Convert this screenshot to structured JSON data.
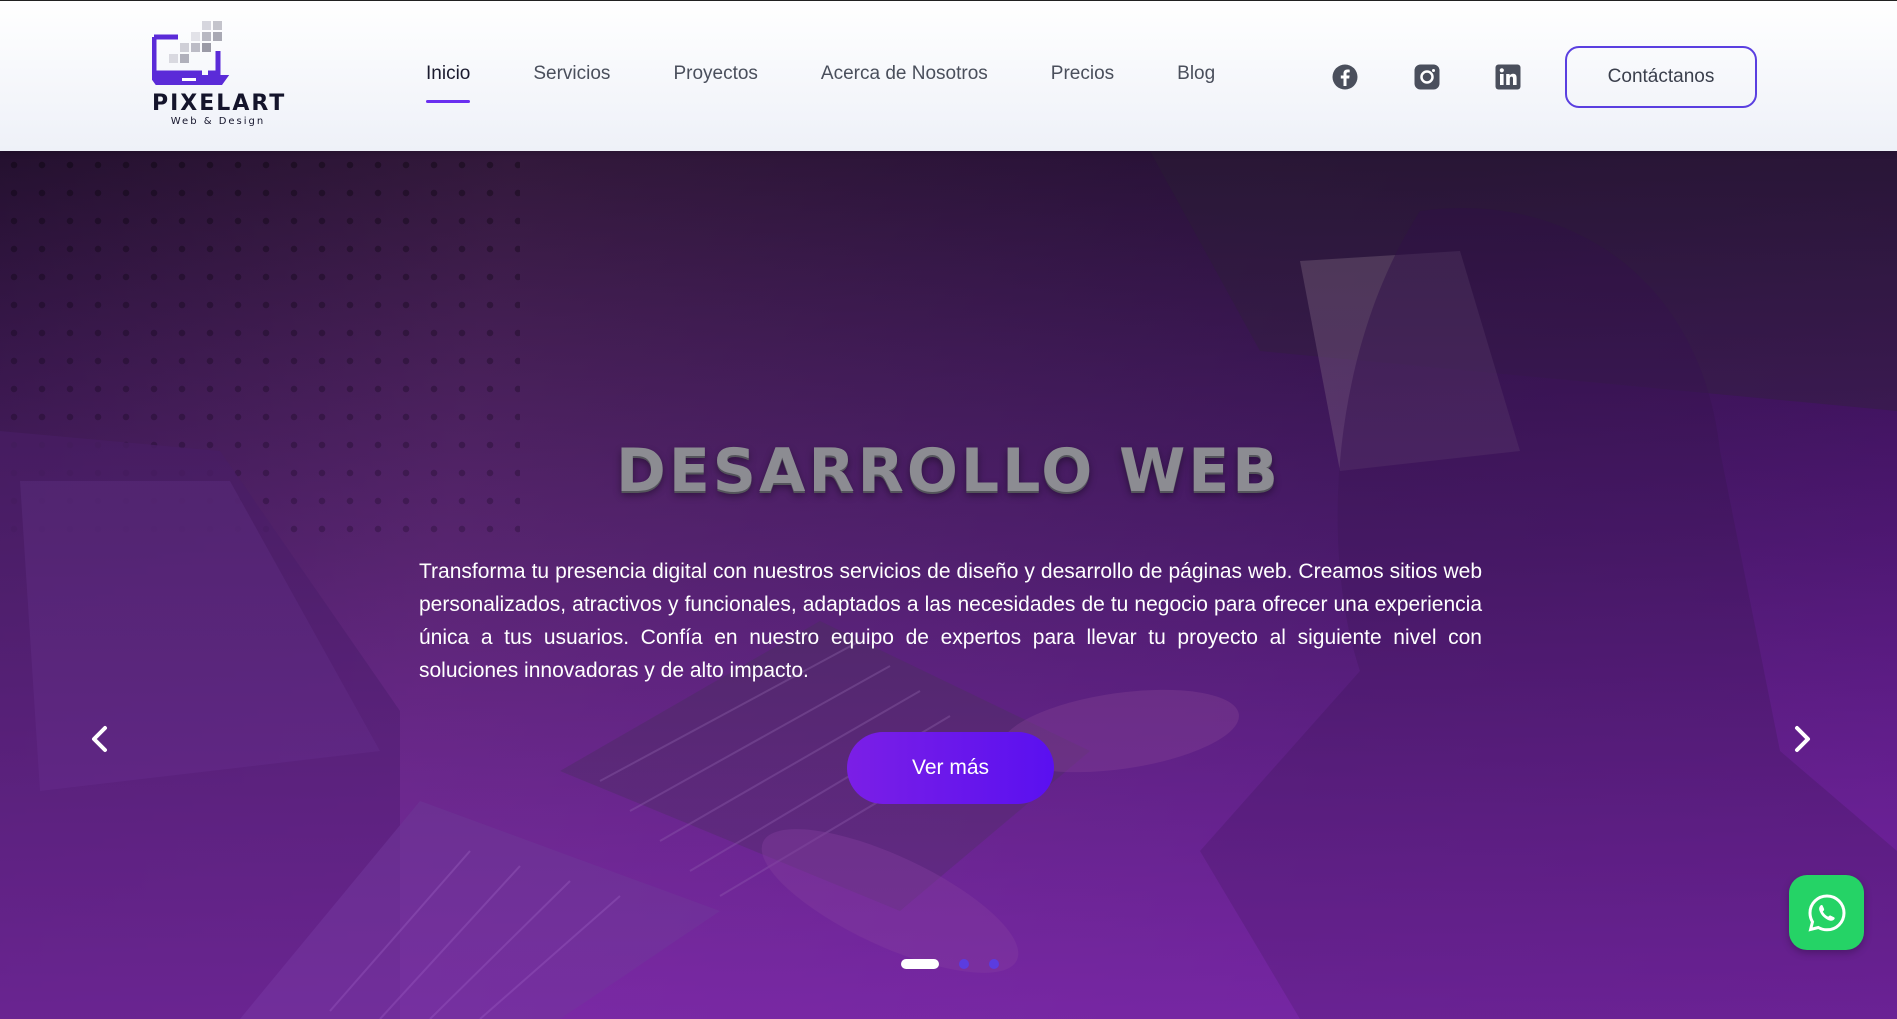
{
  "brand": {
    "name": "PIXELART",
    "tagline": "Web & Design",
    "accent_color": "#6a2ff0",
    "text_color": "#14142b"
  },
  "nav": {
    "items": [
      {
        "label": "Inicio",
        "active": true
      },
      {
        "label": "Servicios",
        "active": false
      },
      {
        "label": "Proyectos",
        "active": false
      },
      {
        "label": "Acerca de Nosotros",
        "active": false
      },
      {
        "label": "Precios",
        "active": false
      },
      {
        "label": "Blog",
        "active": false
      }
    ]
  },
  "social": {
    "icons": [
      "facebook-icon",
      "instagram-icon",
      "linkedin-icon"
    ]
  },
  "header": {
    "contact_label": "Contáctanos"
  },
  "hero": {
    "title": "DESARROLLO WEB",
    "description": "Transforma tu presencia digital con nuestros servicios de diseño y desarrollo de páginas web. Creamos sitios web personalizados, atractivos y funcionales, adaptados a las necesidades de tu negocio para ofrecer una experiencia única a tus usuarios. Confía en nuestro equipo de expertos para llevar tu proyecto al siguiente nivel con soluciones innovadoras y de alto impacto.",
    "cta_label": "Ver más",
    "cta_color": "#6a18ec",
    "slides_total": 3,
    "active_slide": 1,
    "prev_icon": "chevron-left-icon",
    "next_icon": "chevron-right-icon"
  },
  "floating": {
    "whatsapp_icon": "whatsapp-icon",
    "whatsapp_color": "#25d366"
  }
}
